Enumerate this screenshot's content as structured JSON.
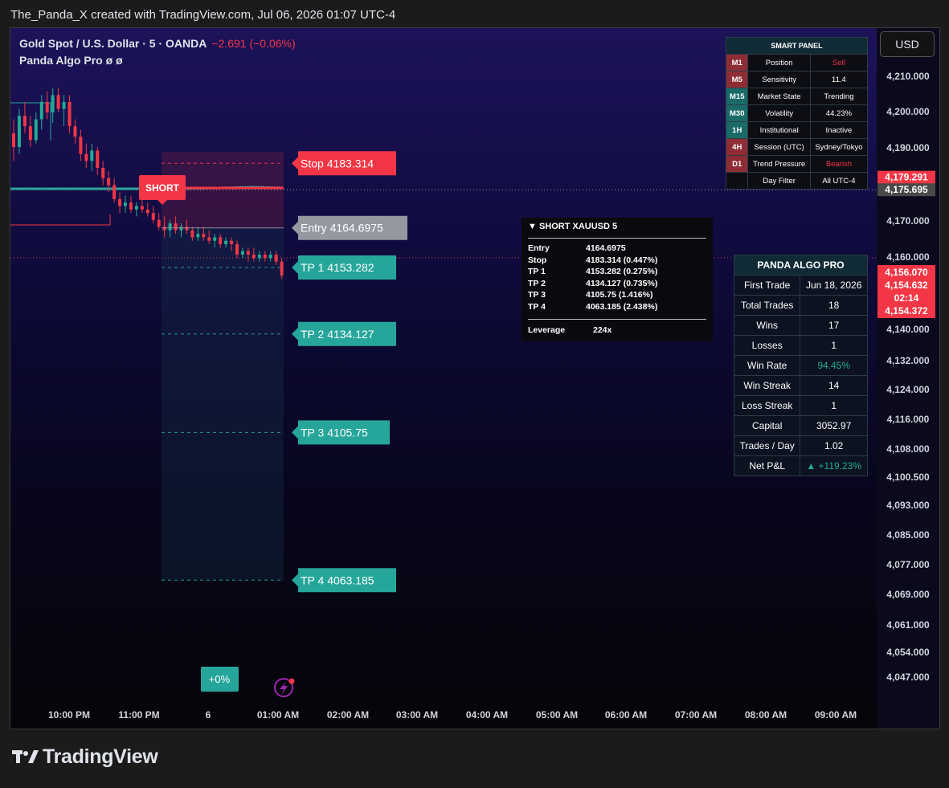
{
  "header": {
    "caption": "The_Panda_X created with TradingView.com, Jul 06, 2026 01:07 UTC-4"
  },
  "symbol": {
    "title": "Gold Spot / U.S. Dollar · 5 · OANDA",
    "change": "−2.691 (−0.06%)",
    "indicator": "Panda Algo Pro  ø  ø"
  },
  "currency_button": "USD",
  "brand": "TradingView",
  "colors": {
    "up": "#22ab94",
    "down": "#f23645",
    "stop": "#f23645",
    "entry": "#9598a1",
    "tp": "#26a69a"
  },
  "chart_data": {
    "type": "candlestick",
    "instrument": "Gold Spot / U.S. Dollar",
    "y_ticks": [
      "4,210.000",
      "4,200.000",
      "4,190.000",
      "4,170.000",
      "4,160.000",
      "4,140.000",
      "4,132.000",
      "4,124.000",
      "4,116.000",
      "4,108.000",
      "4,100.500",
      "4,093.000",
      "4,085.000",
      "4,077.000",
      "4,069.000",
      "4,061.000",
      "4,054.000",
      "4,047.000"
    ],
    "x_ticks": [
      "10:00 PM",
      "11:00 PM",
      "6",
      "01:00 AM",
      "02:00 AM",
      "03:00 AM",
      "04:00 AM",
      "05:00 AM",
      "06:00 AM",
      "07:00 AM",
      "08:00 AM",
      "09:00 AM"
    ],
    "price_tags": [
      {
        "value": 4179.291,
        "label": "4,179.291",
        "color": "#f23645"
      },
      {
        "value": 4175.695,
        "label": "4,175.695",
        "color": "#4a4a4a"
      }
    ],
    "last_price_box": {
      "lines": [
        "4,156.070",
        "4,154.632",
        "02:14",
        "4,154.372"
      ],
      "color": "#f23645"
    },
    "levels": [
      {
        "name": "Stop",
        "label": "Stop  4183.314",
        "value": 4183.314,
        "color": "#f23645"
      },
      {
        "name": "Entry",
        "label": "Entry  4164.6975",
        "value": 4164.6975,
        "color": "#9598a1"
      },
      {
        "name": "TP 1",
        "label": "TP 1  4153.282",
        "value": 4153.282,
        "color": "#26a69a"
      },
      {
        "name": "TP 2",
        "label": "TP 2  4134.127",
        "value": 4134.127,
        "color": "#26a69a"
      },
      {
        "name": "TP 3",
        "label": "TP 3  4105.75",
        "value": 4105.75,
        "color": "#26a69a"
      },
      {
        "name": "TP 4",
        "label": "TP 4  4063.185",
        "value": 4063.185,
        "color": "#26a69a"
      }
    ],
    "signal_label": "SHORT",
    "badge": "+0%",
    "candles": [
      {
        "o": 4192,
        "h": 4196,
        "l": 4184,
        "c": 4188
      },
      {
        "o": 4188,
        "h": 4199,
        "l": 4186,
        "c": 4197
      },
      {
        "o": 4197,
        "h": 4201,
        "l": 4192,
        "c": 4194
      },
      {
        "o": 4194,
        "h": 4197,
        "l": 4188,
        "c": 4190
      },
      {
        "o": 4190,
        "h": 4198,
        "l": 4189,
        "c": 4196
      },
      {
        "o": 4196,
        "h": 4203,
        "l": 4193,
        "c": 4201
      },
      {
        "o": 4201,
        "h": 4204,
        "l": 4196,
        "c": 4198
      },
      {
        "o": 4198,
        "h": 4205,
        "l": 4195,
        "c": 4203
      },
      {
        "o": 4203,
        "h": 4205,
        "l": 4198,
        "c": 4199
      },
      {
        "o": 4199,
        "h": 4203,
        "l": 4194,
        "c": 4201
      },
      {
        "o": 4201,
        "h": 4203,
        "l": 4192,
        "c": 4194
      },
      {
        "o": 4194,
        "h": 4196,
        "l": 4189,
        "c": 4191
      },
      {
        "o": 4191,
        "h": 4193,
        "l": 4184,
        "c": 4186
      },
      {
        "o": 4186,
        "h": 4189,
        "l": 4182,
        "c": 4184
      },
      {
        "o": 4184,
        "h": 4189,
        "l": 4181,
        "c": 4187
      },
      {
        "o": 4187,
        "h": 4188,
        "l": 4180,
        "c": 4182
      },
      {
        "o": 4182,
        "h": 4184,
        "l": 4177,
        "c": 4179
      },
      {
        "o": 4179,
        "h": 4181,
        "l": 4175,
        "c": 4177
      },
      {
        "o": 4177,
        "h": 4179,
        "l": 4172,
        "c": 4173
      },
      {
        "o": 4173,
        "h": 4175,
        "l": 4169,
        "c": 4171
      },
      {
        "o": 4171,
        "h": 4174,
        "l": 4169,
        "c": 4172
      },
      {
        "o": 4172,
        "h": 4174,
        "l": 4169,
        "c": 4170
      },
      {
        "o": 4170,
        "h": 4172,
        "l": 4168,
        "c": 4171
      },
      {
        "o": 4171,
        "h": 4173,
        "l": 4169,
        "c": 4170
      },
      {
        "o": 4170,
        "h": 4172,
        "l": 4168,
        "c": 4169
      },
      {
        "o": 4169,
        "h": 4171,
        "l": 4166,
        "c": 4167
      },
      {
        "o": 4167,
        "h": 4169,
        "l": 4164,
        "c": 4165
      },
      {
        "o": 4165,
        "h": 4168,
        "l": 4162,
        "c": 4164
      },
      {
        "o": 4164,
        "h": 4167,
        "l": 4162,
        "c": 4166
      },
      {
        "o": 4166,
        "h": 4168,
        "l": 4163,
        "c": 4164
      },
      {
        "o": 4164,
        "h": 4166,
        "l": 4162,
        "c": 4165
      },
      {
        "o": 4165,
        "h": 4167,
        "l": 4163,
        "c": 4164
      },
      {
        "o": 4164,
        "h": 4165,
        "l": 4161,
        "c": 4162
      },
      {
        "o": 4162,
        "h": 4165,
        "l": 4161,
        "c": 4163
      },
      {
        "o": 4163,
        "h": 4165,
        "l": 4161,
        "c": 4162
      },
      {
        "o": 4162,
        "h": 4164,
        "l": 4160,
        "c": 4161
      },
      {
        "o": 4161,
        "h": 4163,
        "l": 4159,
        "c": 4162
      },
      {
        "o": 4162,
        "h": 4163,
        "l": 4159,
        "c": 4160
      },
      {
        "o": 4160,
        "h": 4162,
        "l": 4159,
        "c": 4161
      },
      {
        "o": 4161,
        "h": 4162,
        "l": 4158,
        "c": 4160
      },
      {
        "o": 4160,
        "h": 4161,
        "l": 4156,
        "c": 4157
      },
      {
        "o": 4157,
        "h": 4159,
        "l": 4156,
        "c": 4158
      },
      {
        "o": 4158,
        "h": 4159,
        "l": 4155,
        "c": 4157
      },
      {
        "o": 4157,
        "h": 4159,
        "l": 4155,
        "c": 4156
      },
      {
        "o": 4156,
        "h": 4158,
        "l": 4155,
        "c": 4157
      },
      {
        "o": 4157,
        "h": 4158,
        "l": 4155,
        "c": 4156
      },
      {
        "o": 4156,
        "h": 4158,
        "l": 4155,
        "c": 4157
      },
      {
        "o": 4157,
        "h": 4158,
        "l": 4154,
        "c": 4155
      },
      {
        "o": 4155,
        "h": 4156,
        "l": 4150,
        "c": 4151
      }
    ]
  },
  "smart_panel": {
    "title": "SMART  PANEL",
    "rows": [
      {
        "tf": "M1",
        "tf_color": "#8e2d35",
        "label": "Position",
        "value": "Sell",
        "value_color": "#f23645"
      },
      {
        "tf": "M5",
        "tf_color": "#8e2d35",
        "label": "Sensitivity",
        "value": "11.4",
        "value_color": "#ffffff"
      },
      {
        "tf": "M15",
        "tf_color": "#1a6b68",
        "label": "Market State",
        "value": "Trending",
        "value_color": "#ffffff"
      },
      {
        "tf": "M30",
        "tf_color": "#1a6b68",
        "label": "Volatility",
        "value": "44.23%",
        "value_color": "#ffffff"
      },
      {
        "tf": "1H",
        "tf_color": "#1a6b68",
        "label": "Institutional",
        "value": "Inactive",
        "value_color": "#ffffff"
      },
      {
        "tf": "4H",
        "tf_color": "#8e2d35",
        "label": "Session (UTC)",
        "value": "Sydney/Tokyo",
        "value_color": "#ffffff"
      },
      {
        "tf": "D1",
        "tf_color": "#8e2d35",
        "label": "Trend Pressure",
        "value": "Bearish",
        "value_color": "#f23645"
      },
      {
        "tf": "",
        "tf_color": "#0d0d14",
        "label": "Day Filter",
        "value": "All  UTC-4",
        "value_color": "#ffffff"
      }
    ]
  },
  "trade_info": {
    "title": "▼  SHORT     XAUUSD     5",
    "rows": [
      {
        "k": "Entry",
        "v": "4164.6975"
      },
      {
        "k": "Stop",
        "v": "4183.314   (0.447%)"
      },
      {
        "k": "TP 1",
        "v": "4153.282   (0.275%)"
      },
      {
        "k": "TP 2",
        "v": "4134.127   (0.735%)"
      },
      {
        "k": "TP 3",
        "v": "4105.75   (1.416%)"
      },
      {
        "k": "TP 4",
        "v": "4063.185   (2.438%)"
      }
    ],
    "leverage_label": "Leverage",
    "leverage_value": "224x"
  },
  "stats_panel": {
    "title": "PANDA  ALGO  PRO",
    "rows": [
      {
        "k": "First Trade",
        "v": "Jun 18, 2026",
        "color": "#ffffff"
      },
      {
        "k": "Total Trades",
        "v": "18",
        "color": "#ffffff"
      },
      {
        "k": "Wins",
        "v": "17",
        "color": "#ffffff"
      },
      {
        "k": "Losses",
        "v": "1",
        "color": "#ffffff"
      },
      {
        "k": "Win Rate",
        "v": "94.45%",
        "color": "#22ab94"
      },
      {
        "k": "Win Streak",
        "v": "14",
        "color": "#ffffff"
      },
      {
        "k": "Loss Streak",
        "v": "1",
        "color": "#ffffff"
      },
      {
        "k": "Capital",
        "v": "3052.97",
        "color": "#ffffff"
      },
      {
        "k": "Trades / Day",
        "v": "1.02",
        "color": "#ffffff"
      },
      {
        "k": "Net P&L",
        "v": "▲ +119.23%",
        "color": "#22ab94"
      }
    ]
  }
}
